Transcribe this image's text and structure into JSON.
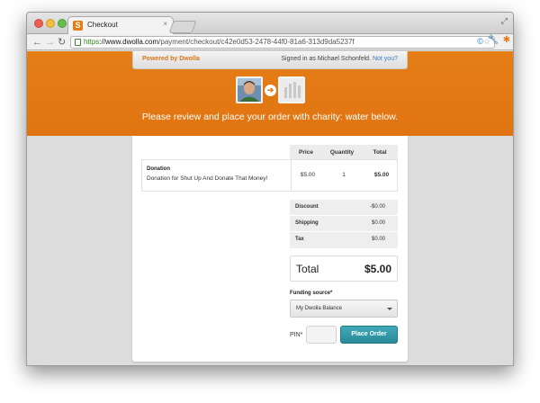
{
  "browser": {
    "tab_title": "Checkout",
    "tab_close": "×",
    "url_secure": "https",
    "url_separator": "://",
    "url_domain": "www.dwolla.com",
    "url_path": "/payment/checkout/c42e0d53-2478-44f0-81a6-313d9da5237f"
  },
  "header": {
    "powered_by": "Powered by Dwolla",
    "signed_in": "Signed in as Michael Schonfeld.",
    "not_you": "Not you?",
    "headline": "Please review and place your order with charity: water below."
  },
  "table": {
    "headers": {
      "price": "Price",
      "quantity": "Quantity",
      "total": "Total"
    },
    "item": {
      "name": "Donation",
      "description": "Donation for Shut Up And Donate That Money!",
      "price": "$5.00",
      "quantity": "1",
      "total": "$5.00"
    }
  },
  "adjustments": [
    {
      "label": "Discount",
      "value": "-$0.00"
    },
    {
      "label": "Shipping",
      "value": "$0.00"
    },
    {
      "label": "Tax",
      "value": "$0.00"
    }
  ],
  "summary": {
    "total_label": "Total",
    "total_value": "$5.00"
  },
  "funding": {
    "label": "Funding source*",
    "selected": "My Dwolla Balance"
  },
  "checkout": {
    "pin_label": "PIN*",
    "pin_value": "",
    "place_order": "Place Order"
  },
  "colors": {
    "brand_orange": "#e07412",
    "button_teal": "#2a8a98",
    "link_blue": "#3a7fc6"
  }
}
